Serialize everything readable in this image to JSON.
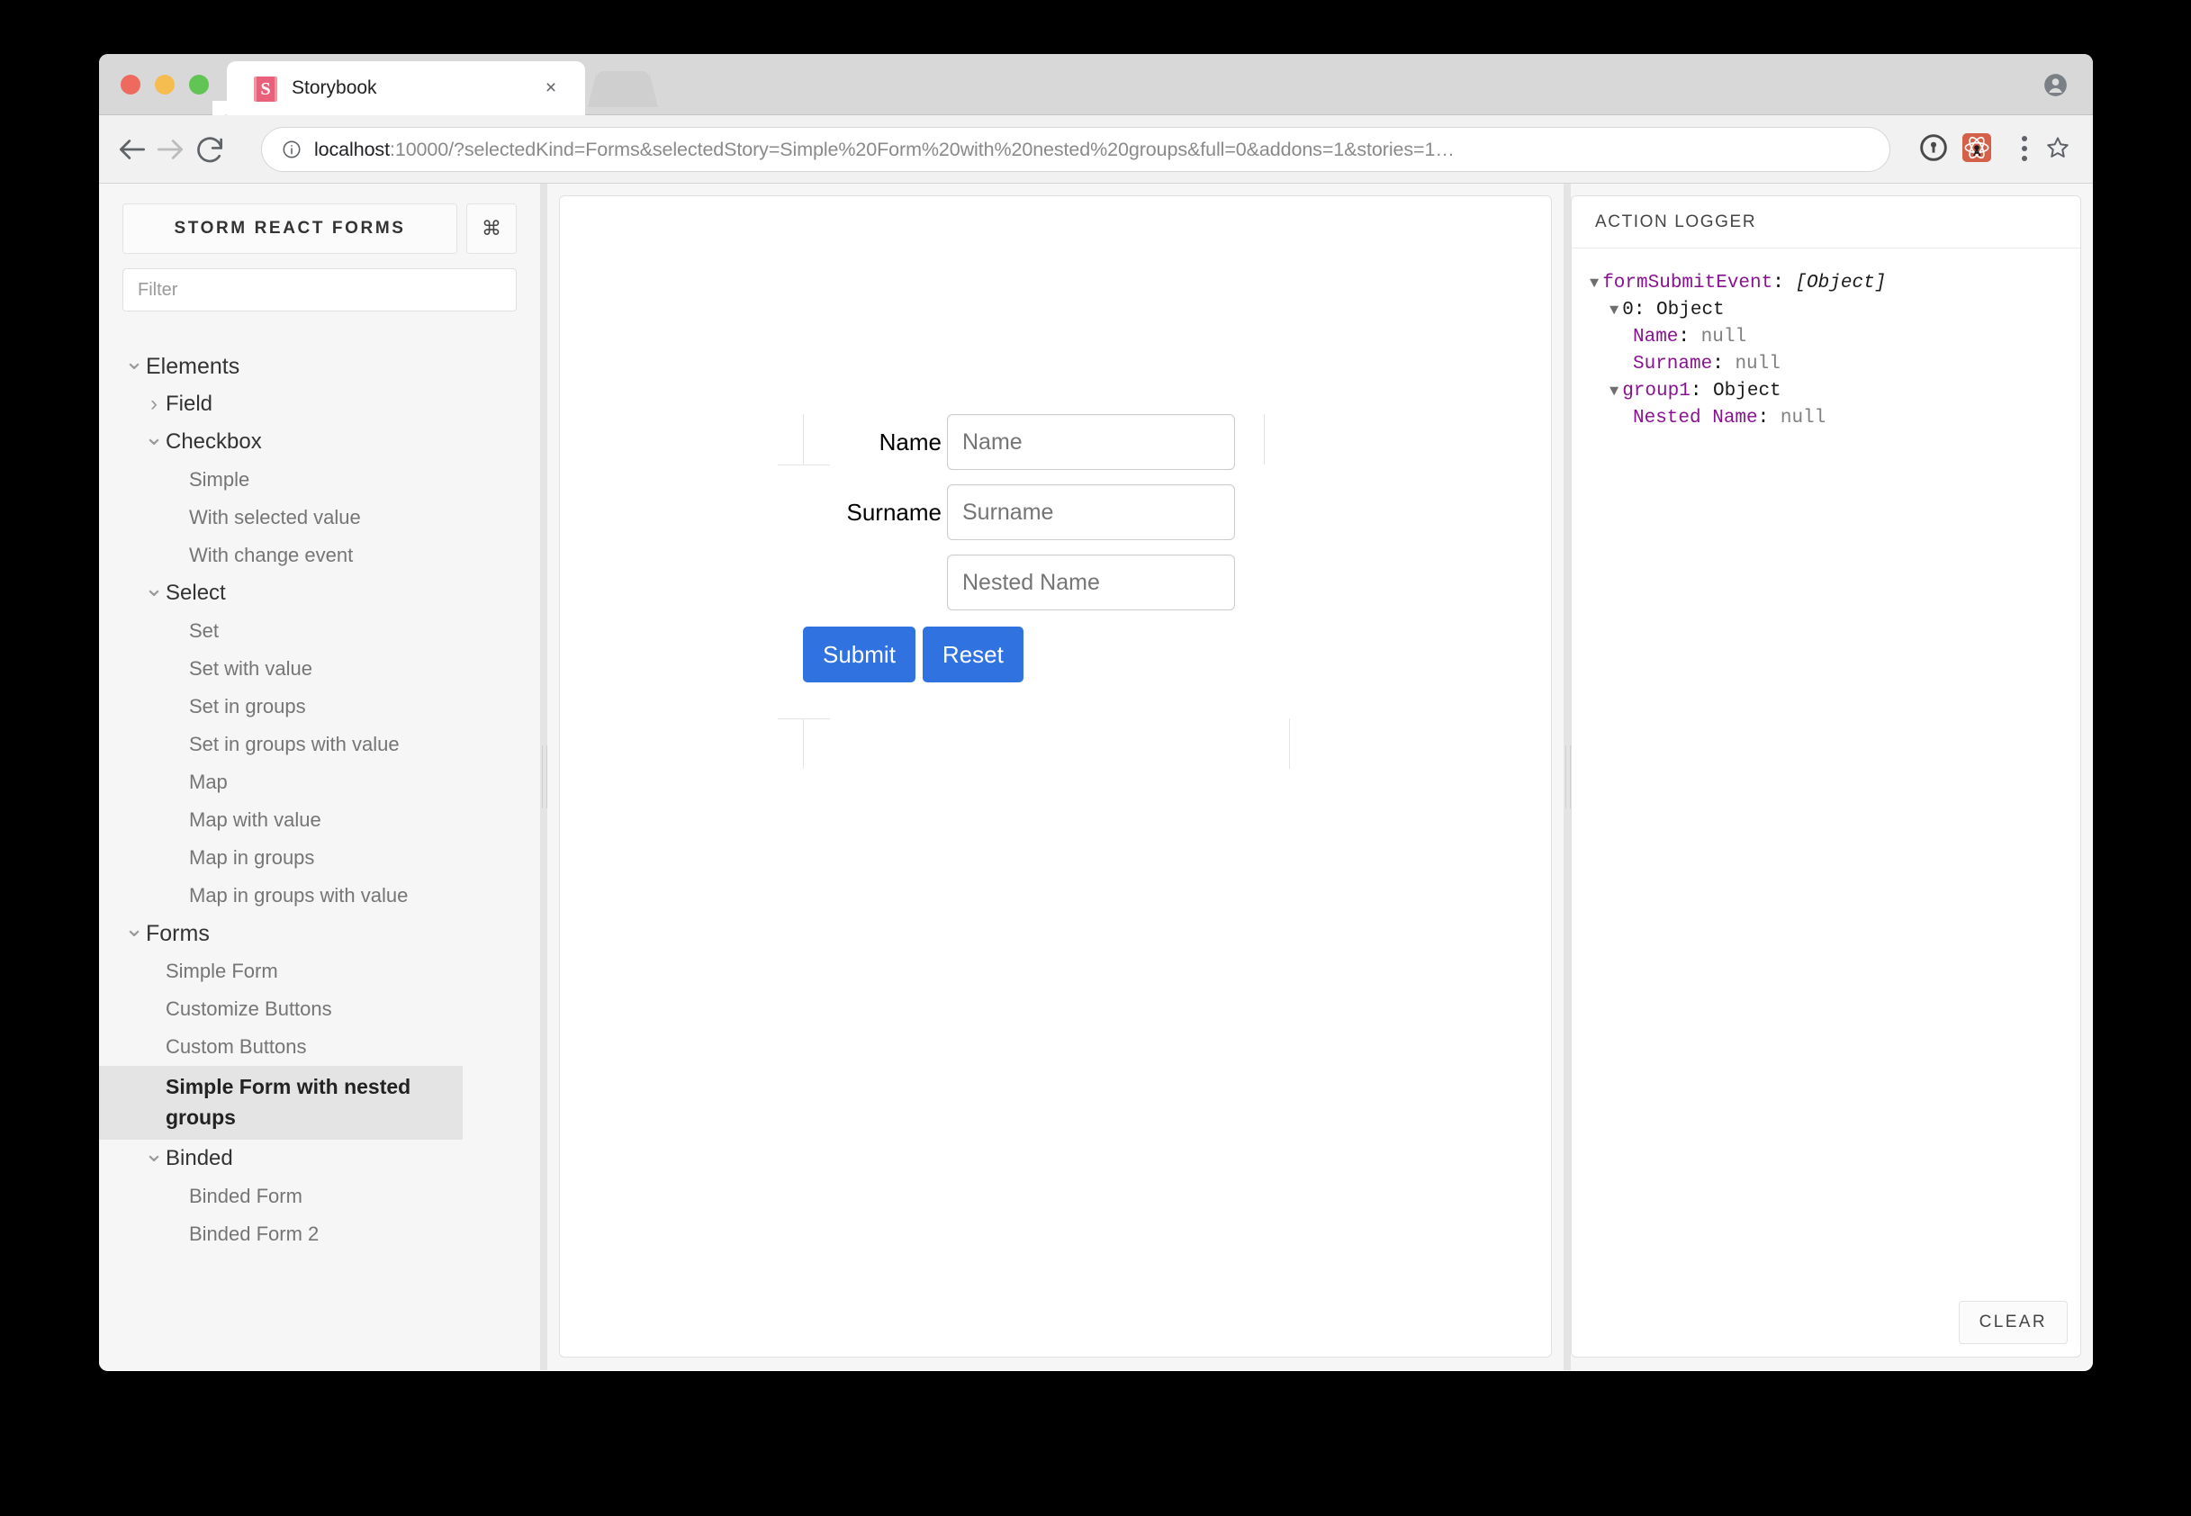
{
  "browser": {
    "tab": {
      "title": "Storybook",
      "favicon_letter": "S",
      "close_label": "×"
    },
    "omnibox": {
      "host": "localhost",
      "rest": ":10000/?selectedKind=Forms&selectedStory=Simple%20Form%20with%20nested%20groups&full=0&addons=1&stories=1…"
    }
  },
  "sidebar": {
    "title": "STORM REACT FORMS",
    "shortcut_glyph": "⌘",
    "filter_placeholder": "Filter",
    "tree": [
      {
        "label": "Elements",
        "level": "root",
        "chevron": "down"
      },
      {
        "label": "Field",
        "level": "lvl1",
        "chevron": "right"
      },
      {
        "label": "Checkbox",
        "level": "lvl1",
        "chevron": "down"
      },
      {
        "label": "Simple",
        "level": "leaf",
        "chevron": ""
      },
      {
        "label": "With selected value",
        "level": "leaf",
        "chevron": ""
      },
      {
        "label": "With change event",
        "level": "leaf",
        "chevron": ""
      },
      {
        "label": "Select",
        "level": "lvl1",
        "chevron": "down"
      },
      {
        "label": "Set",
        "level": "leaf",
        "chevron": ""
      },
      {
        "label": "Set with value",
        "level": "leaf",
        "chevron": ""
      },
      {
        "label": "Set in groups",
        "level": "leaf",
        "chevron": ""
      },
      {
        "label": "Set in groups with value",
        "level": "leaf",
        "chevron": ""
      },
      {
        "label": "Map",
        "level": "leaf",
        "chevron": ""
      },
      {
        "label": "Map with value",
        "level": "leaf",
        "chevron": ""
      },
      {
        "label": "Map in groups",
        "level": "leaf",
        "chevron": ""
      },
      {
        "label": "Map in groups with value",
        "level": "leaf",
        "chevron": ""
      },
      {
        "label": "Forms",
        "level": "root",
        "chevron": "down"
      },
      {
        "label": "Simple Form",
        "level": "leaf2",
        "chevron": ""
      },
      {
        "label": "Customize Buttons",
        "level": "leaf2",
        "chevron": ""
      },
      {
        "label": "Custom Buttons",
        "level": "leaf2",
        "chevron": ""
      },
      {
        "label": "Simple Form with nested groups",
        "level": "selected",
        "chevron": ""
      },
      {
        "label": "Binded",
        "level": "lvl1",
        "chevron": "down"
      },
      {
        "label": "Binded Form",
        "level": "leaf",
        "chevron": ""
      },
      {
        "label": "Binded Form 2",
        "level": "leaf",
        "chevron": ""
      }
    ]
  },
  "story": {
    "fields": [
      {
        "label": "Name",
        "placeholder": "Name",
        "value": ""
      },
      {
        "label": "Surname",
        "placeholder": "Surname",
        "value": ""
      },
      {
        "label": "",
        "placeholder": "Nested Name",
        "value": ""
      }
    ],
    "submit_label": "Submit",
    "reset_label": "Reset"
  },
  "panel": {
    "tab_label": "ACTION LOGGER",
    "clear_label": "CLEAR",
    "log": [
      {
        "indent": 0,
        "arrow": "▼",
        "key": "formSubmitEvent",
        "key_style": "k",
        "value": "[Object]",
        "value_style": "v-obj"
      },
      {
        "indent": 1,
        "arrow": "▼",
        "key": "0",
        "key_style": "k-dark",
        "value": "Object",
        "value_style": "k-dark"
      },
      {
        "indent": 2,
        "arrow": "",
        "key": "Name",
        "key_style": "k",
        "value": "null",
        "value_style": "v-null"
      },
      {
        "indent": 2,
        "arrow": "",
        "key": "Surname",
        "key_style": "k",
        "value": "null",
        "value_style": "v-null"
      },
      {
        "indent": 1,
        "arrow": "▼",
        "key": "group1",
        "key_style": "k",
        "value": "Object",
        "value_style": "k-dark"
      },
      {
        "indent": 2,
        "arrow": "",
        "key": "Nested Name",
        "key_style": "k",
        "value": "null",
        "value_style": "v-null"
      }
    ]
  },
  "colors": {
    "accent_button": "#2f72e0",
    "sidebar_bg": "#f6f6f6",
    "selected_bg": "#e4e4e4",
    "log_key": "#881391",
    "react_ext": "#d4604a"
  }
}
